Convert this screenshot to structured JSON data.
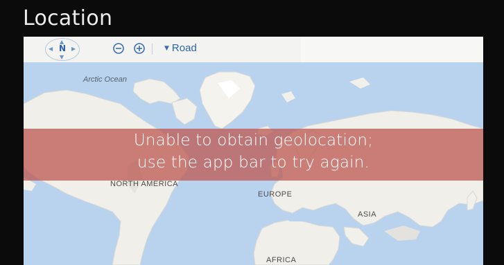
{
  "window": {
    "title": "Location"
  },
  "map": {
    "toolbar": {
      "compass_label": "N",
      "map_style_label": "Road"
    },
    "labels": {
      "arctic_ocean": "Arctic Ocean",
      "north_america": "NORTH AMERICA",
      "europe": "EUROPE",
      "asia": "ASIA",
      "africa": "AFRICA"
    }
  },
  "error_banner": {
    "line1": "Unable to obtain geolocation;",
    "line2": "use the app bar to try again."
  },
  "colors": {
    "background": "#0b0b0b",
    "water": "#b9d3ee",
    "land": "#f2f1ec",
    "banner": "#be5c56",
    "link_blue": "#2f64ad"
  }
}
